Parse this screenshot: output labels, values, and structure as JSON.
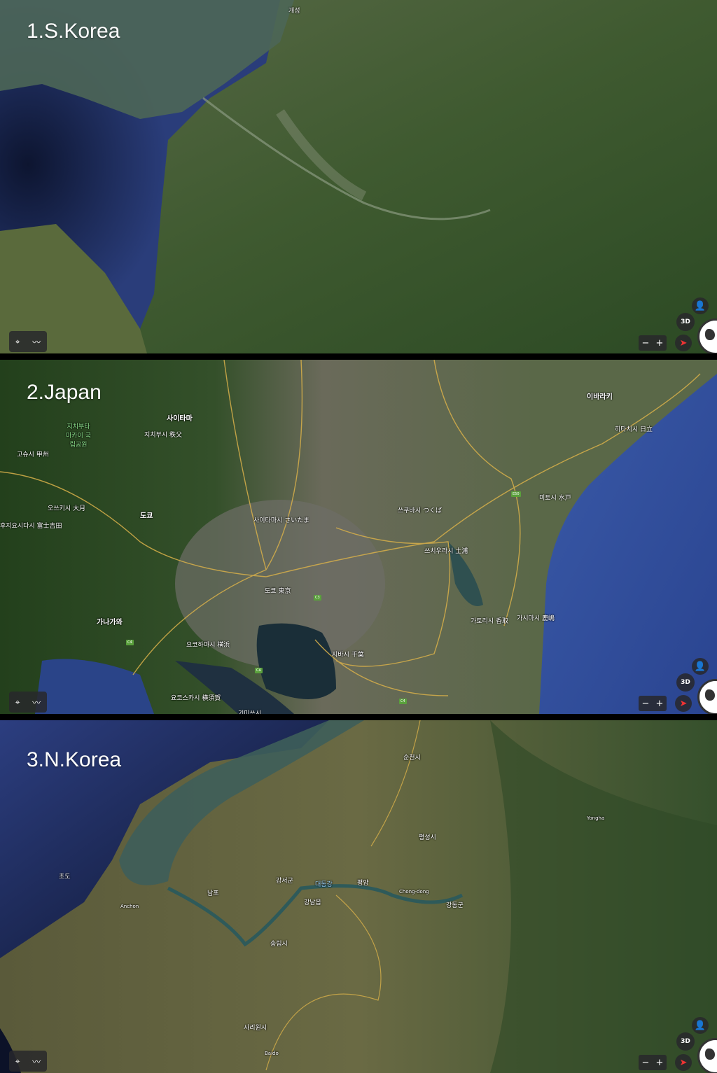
{
  "panels": [
    {
      "title": "1.S.Korea",
      "labels": [
        "개성"
      ]
    },
    {
      "title": "2.Japan",
      "labels": [
        "사이타마",
        "지치부시 秩父",
        "지치부타 마카이 국립공원",
        "고슈시 甲州",
        "오쓰키시 大月",
        "도쿄",
        "사이타마시 さいたま",
        "도쿄 東京",
        "지바시 千葉",
        "쓰쿠바시 つくば",
        "쓰치우라시 土浦",
        "이바라키",
        "히타치시 日立",
        "미토시 水戸",
        "가나가와",
        "요코하마시 横浜",
        "요코스카시 横須賀",
        "기미쓰시",
        "가시마시 鹿嶋",
        "가토리시 香取",
        "후지요시다시 富士吉田"
      ],
      "shields": [
        "C4",
        "C3",
        "CA",
        "C4",
        "E50"
      ]
    },
    {
      "title": "3.N.Korea",
      "labels": [
        "평양",
        "대동강",
        "강서군",
        "강남읍",
        "Chong-dong",
        "강동군",
        "남포",
        "초도",
        "Anchon",
        "송림시",
        "사리원시",
        "순천시",
        "평성시",
        "Yongha",
        "Baido"
      ]
    }
  ],
  "controls": {
    "location_icon": "map-pin-icon",
    "elevation_icon": "elevation-icon",
    "person_icon": "pegman-icon",
    "three_d_label": "3D",
    "zoom_out_label": "−",
    "zoom_in_label": "+",
    "compass_icon": "compass-icon",
    "globe_icon": "globe-icon"
  },
  "colors": {
    "land": "#3e5a2c",
    "sea_deep": "#1c2a5a",
    "sea_shallow": "#3b5a50",
    "road": "#e0b850",
    "shield": "#5aa03c"
  }
}
